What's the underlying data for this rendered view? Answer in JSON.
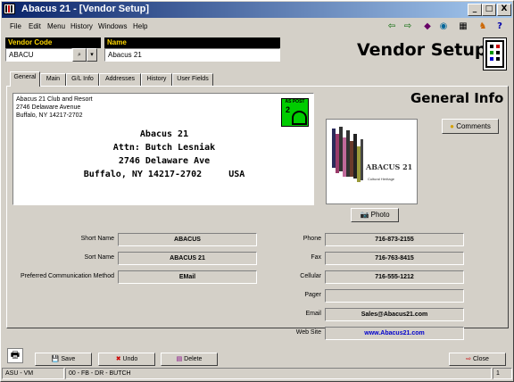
{
  "window": {
    "title": "Abacus 21 - [Vendor Setup]",
    "controls": [
      "_",
      "□",
      "X"
    ]
  },
  "menu": [
    "File",
    "Edit",
    "Menu",
    "History",
    "Windows",
    "Help"
  ],
  "toolbar_icons": [
    "left-arrow-icon",
    "right-arrow-icon",
    "eye-icon",
    "globe-icon",
    "calculator-icon",
    "runner-icon",
    "help-icon"
  ],
  "vendor_code": {
    "label": "Vendor Code",
    "value": "ABACU"
  },
  "name": {
    "label": "Name",
    "value": "Abacus 21"
  },
  "page_title": "Vendor Setup",
  "tabs": [
    "General",
    "Main",
    "G/L Info",
    "Addresses",
    "History",
    "User Fields"
  ],
  "section_title": "General Info",
  "address_small": [
    "Abacus 21 Club and Resort",
    "2746 Delaware Avenue",
    "Buffalo, NY 14217-2702"
  ],
  "address_big": [
    "Abacus 21",
    "Attn: Butch Lesniak",
    "2746 Delaware Ave",
    "Buffalo, NY 14217-2702     USA"
  ],
  "postage_badge": {
    "line1": "AS POST",
    "line2": "2"
  },
  "comments_label": "Comments",
  "photo_label": "Photo",
  "logo_text": "ABACUS 21",
  "logo_subtext": "Cultural Heritage",
  "left_fields": [
    {
      "label": "Short Name",
      "value": "ABACUS"
    },
    {
      "label": "Sort Name",
      "value": "ABACUS 21"
    },
    {
      "label": "Preferred Communication Method",
      "value": "EMail"
    }
  ],
  "right_fields": [
    {
      "label": "Phone",
      "value": "716-873-2155"
    },
    {
      "label": "Fax",
      "value": "716-763-8415"
    },
    {
      "label": "Cellular",
      "value": "716-555-1212"
    },
    {
      "label": "Pager",
      "value": ""
    },
    {
      "label": "Email",
      "value": "Sales@Abacus21.com"
    },
    {
      "label": "Web Site",
      "value": "www.Abacus21.com"
    }
  ],
  "buttons": {
    "save": "Save",
    "undo": "Undo",
    "delete": "Delete",
    "close": "Close"
  },
  "status": {
    "user": "ASU - VM",
    "code": "00 - FB - DR - BUTCH",
    "page": "1"
  },
  "colors": {
    "title_start": "#0a246a",
    "title_end": "#a6caf0",
    "label_bg": "#000000",
    "label_fg": "#ffd700",
    "link": "#0000cc"
  }
}
